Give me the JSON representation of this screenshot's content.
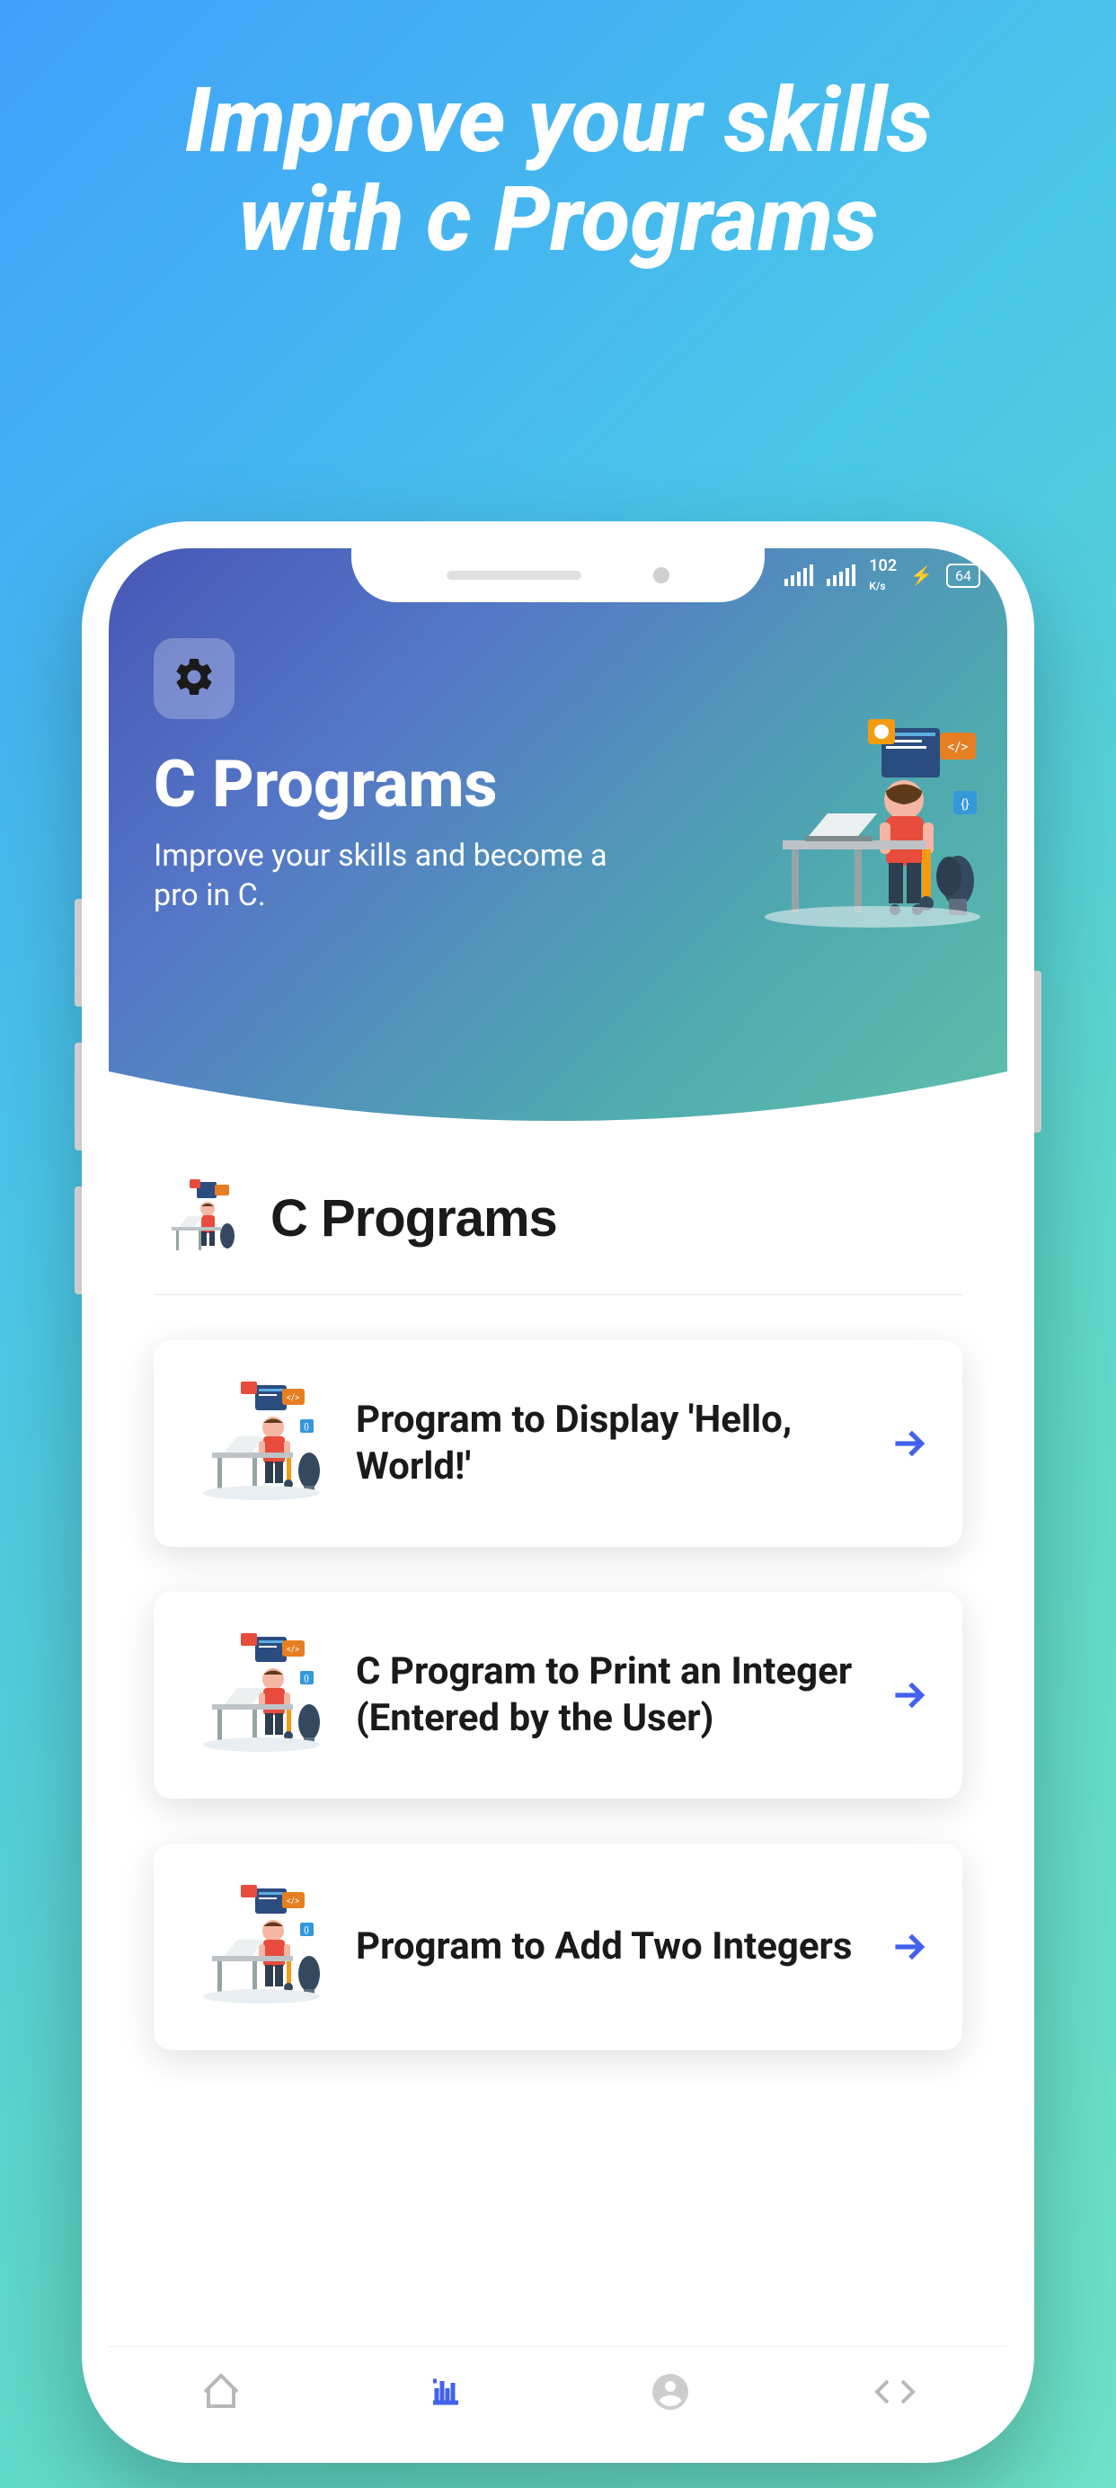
{
  "promo": {
    "title_line1": "Improve your skills",
    "title_line2": "with c Programs"
  },
  "statusbar": {
    "speed": "102",
    "speed_unit": "K/s",
    "battery": "64"
  },
  "hero": {
    "title": "C Programs",
    "subtitle": "Improve your skills and become a pro in C."
  },
  "section": {
    "title": "C Programs"
  },
  "programs": [
    {
      "title": "Program to Display 'Hello, World!'"
    },
    {
      "title": "C Program to Print an Integer (Entered by the User)"
    },
    {
      "title": "Program to Add Two Integers"
    }
  ],
  "colors": {
    "accent": "#4261EE",
    "text_primary": "#1a1a1a"
  }
}
